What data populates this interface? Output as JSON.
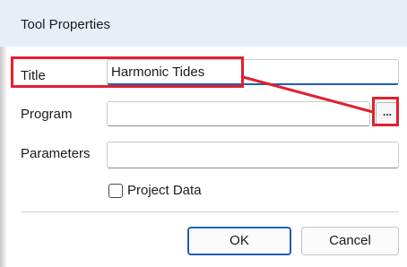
{
  "dialog": {
    "title": "Tool Properties"
  },
  "fields": {
    "title_label": "Title",
    "title_value": "Harmonic Tides",
    "program_label": "Program",
    "program_value": "",
    "parameters_label": "Parameters",
    "parameters_value": "",
    "browse_label": "..."
  },
  "options": {
    "project_data_label": "Project Data",
    "project_data_checked": false
  },
  "buttons": {
    "ok_label": "OK",
    "cancel_label": "Cancel"
  },
  "colors": {
    "highlight": "#e0202e",
    "accent": "#1f5fb5",
    "titlebar": "#e8eef8"
  }
}
